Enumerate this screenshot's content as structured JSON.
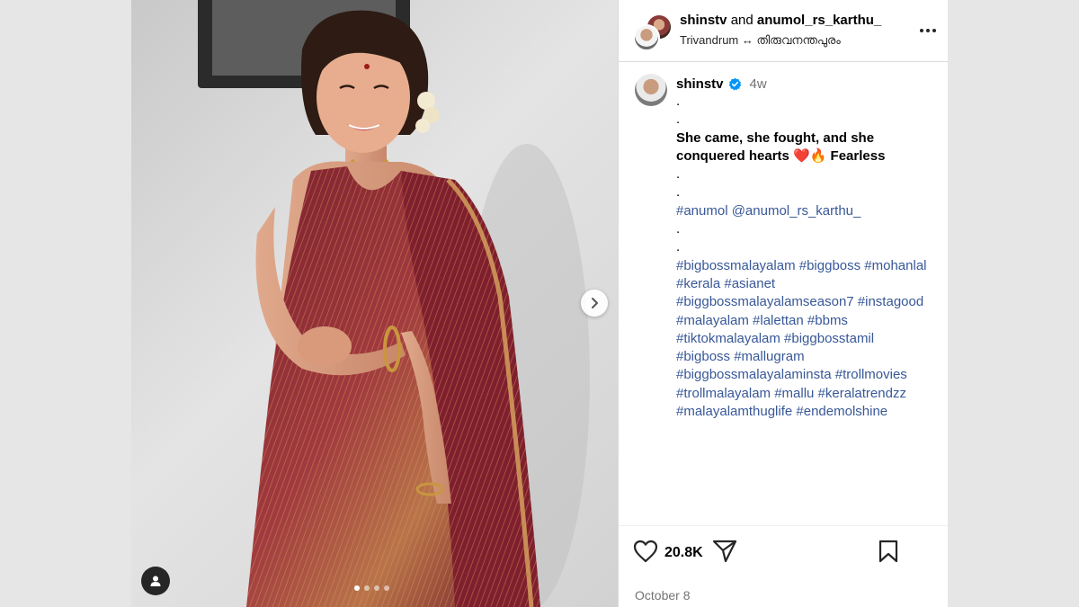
{
  "header": {
    "user_primary": "shinstv",
    "joiner": "and",
    "user_collab": "anumol_rs_karthu_",
    "location": "Trivandrum ↔ തിരുവനന്തപുരം",
    "more_icon": "more-dots-icon"
  },
  "caption": {
    "username": "shinstv",
    "verified_icon": "verified-badge-icon",
    "time_ago": "4w",
    "lines": [
      {
        "text": ".",
        "style": "plain"
      },
      {
        "text": ".",
        "style": "plain"
      },
      {
        "text": "She came, she fought, and she",
        "style": "bold"
      },
      {
        "text": "conquered hearts ❤️🔥 Fearless",
        "style": "bold"
      },
      {
        "text": ".",
        "style": "plain"
      },
      {
        "text": ".",
        "style": "plain"
      },
      {
        "text": "#anumol @anumol_rs_karthu_",
        "style": "tag"
      },
      {
        "text": ".",
        "style": "plain"
      },
      {
        "text": ".",
        "style": "plain"
      },
      {
        "text": "#bigbossmalayalam #biggboss #mohanlal",
        "style": "tag"
      },
      {
        "text": "#kerala #asianet",
        "style": "tag"
      },
      {
        "text": "#biggbossmalayalamseason7 #instagood",
        "style": "tag"
      },
      {
        "text": "#malayalam #lalettan #bbms",
        "style": "tag"
      },
      {
        "text": "#tiktokmalayalam #biggbosstamil",
        "style": "tag"
      },
      {
        "text": "#bigboss #mallugram",
        "style": "tag"
      },
      {
        "text": "#biggbossmalayalaminsta #trollmovies",
        "style": "tag"
      },
      {
        "text": "#trollmalayalam #mallu #keralatrendzz",
        "style": "tag"
      },
      {
        "text": "#malayalamthuglife #endemolshine",
        "style": "tag"
      }
    ]
  },
  "actions": {
    "like_icon": "heart-icon",
    "like_count": "20.8K",
    "share_icon": "send-icon",
    "save_icon": "bookmark-icon"
  },
  "post_date": "October 8",
  "media": {
    "carousel_total": 4,
    "carousel_active": 1,
    "next_icon": "chevron-right-icon",
    "tag_icon": "user-tag-icon"
  },
  "colors": {
    "link": "#385898",
    "verified": "#0095f6",
    "saree": "#8a2232",
    "gold": "#c9963f"
  }
}
